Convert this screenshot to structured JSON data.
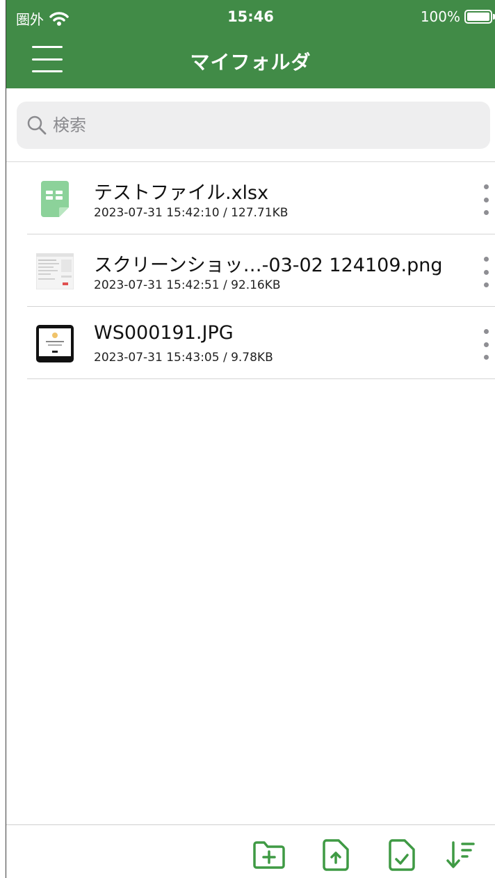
{
  "status_bar": {
    "carrier": "圏外",
    "time": "15:46",
    "battery": "100%"
  },
  "header": {
    "title": "マイフォルダ",
    "menu_icon": "hamburger-menu-icon"
  },
  "search": {
    "placeholder": "検索",
    "value": ""
  },
  "files": [
    {
      "name": "テストファイル.xlsx",
      "meta": "2023-07-31 15:42:10 / 127.71KB",
      "thumb": "spreadsheet-file-icon"
    },
    {
      "name": "スクリーンショッ…-03-02 124109.png",
      "meta": "2023-07-31 15:42:51 / 92.16KB",
      "thumb": "screenshot-thumbnail"
    },
    {
      "name": "WS000191.JPG",
      "meta": "2023-07-31 15:43:05 / 9.78KB",
      "thumb": "photo-thumbnail"
    }
  ],
  "toolbar": {
    "buttons": [
      "new-folder-icon",
      "upload-file-icon",
      "select-file-icon",
      "sort-icon"
    ]
  },
  "colors": {
    "brand": "#418b47",
    "accent": "#3f9a44"
  }
}
